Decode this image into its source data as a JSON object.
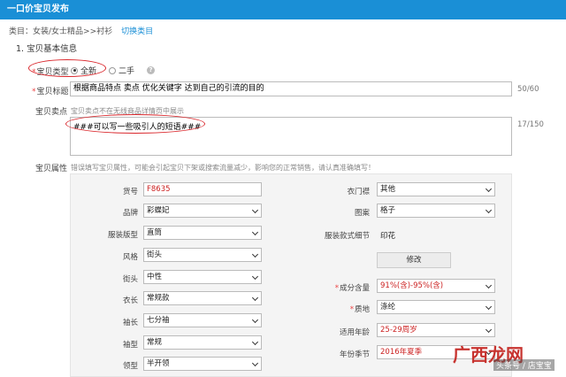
{
  "header": {
    "title": "一口价宝贝发布"
  },
  "category": {
    "path": "类目：女装/女士精品>>衬衫",
    "switch_label": "切换类目"
  },
  "section": {
    "title": "1. 宝贝基本信息"
  },
  "item_type": {
    "label": "宝贝类型",
    "options": [
      "全新",
      "二手"
    ],
    "selected": "全新"
  },
  "item_title": {
    "label": "宝贝标题",
    "value": "根据商品特点 卖点 优化关键字 达到自己的引流的目的",
    "counter": "50/60"
  },
  "selling_point": {
    "label": "宝贝卖点",
    "hint": "宝贝卖点不在无线商品详情页中展示",
    "value": "###可以写一些吸引人的短语###",
    "counter": "17/150"
  },
  "attributes": {
    "label": "宝贝属性",
    "warning": "错误填写宝贝属性，可能会引起宝贝下架或搜索流量减少，影响您的正常销售，请认真准确填写！",
    "left": [
      {
        "label": "货号",
        "value": "F8635"
      },
      {
        "label": "品牌",
        "value": "彩蝶妃"
      },
      {
        "label": "服装版型",
        "value": "直筒"
      },
      {
        "label": "风格",
        "value": "街头"
      },
      {
        "label": "街头",
        "value": "中性"
      },
      {
        "label": "衣长",
        "value": "常规款"
      },
      {
        "label": "袖长",
        "value": "七分袖"
      },
      {
        "label": "袖型",
        "value": "常规"
      },
      {
        "label": "领型",
        "value": "半开领"
      }
    ],
    "right": [
      {
        "label": "衣门襟",
        "value": "其他"
      },
      {
        "label": "图案",
        "value": "格子"
      },
      {
        "label": "服装款式细节",
        "value": "印花"
      },
      {
        "label": "成分含量",
        "value": "91%(含)-95%(含)",
        "required": true
      },
      {
        "label": "质地",
        "value": "涤纶",
        "required": true
      },
      {
        "label": "适用年龄",
        "value": "25-29周岁"
      },
      {
        "label": "年份季节",
        "value": "2016年夏季"
      }
    ],
    "modify_label": "修改"
  },
  "watermark": {
    "main": "广西龙网",
    "sub": "头条号 / 店宝宝"
  },
  "colors": {
    "brand_blue": "#1a8fd6",
    "annotation_red": "#d9262b"
  }
}
